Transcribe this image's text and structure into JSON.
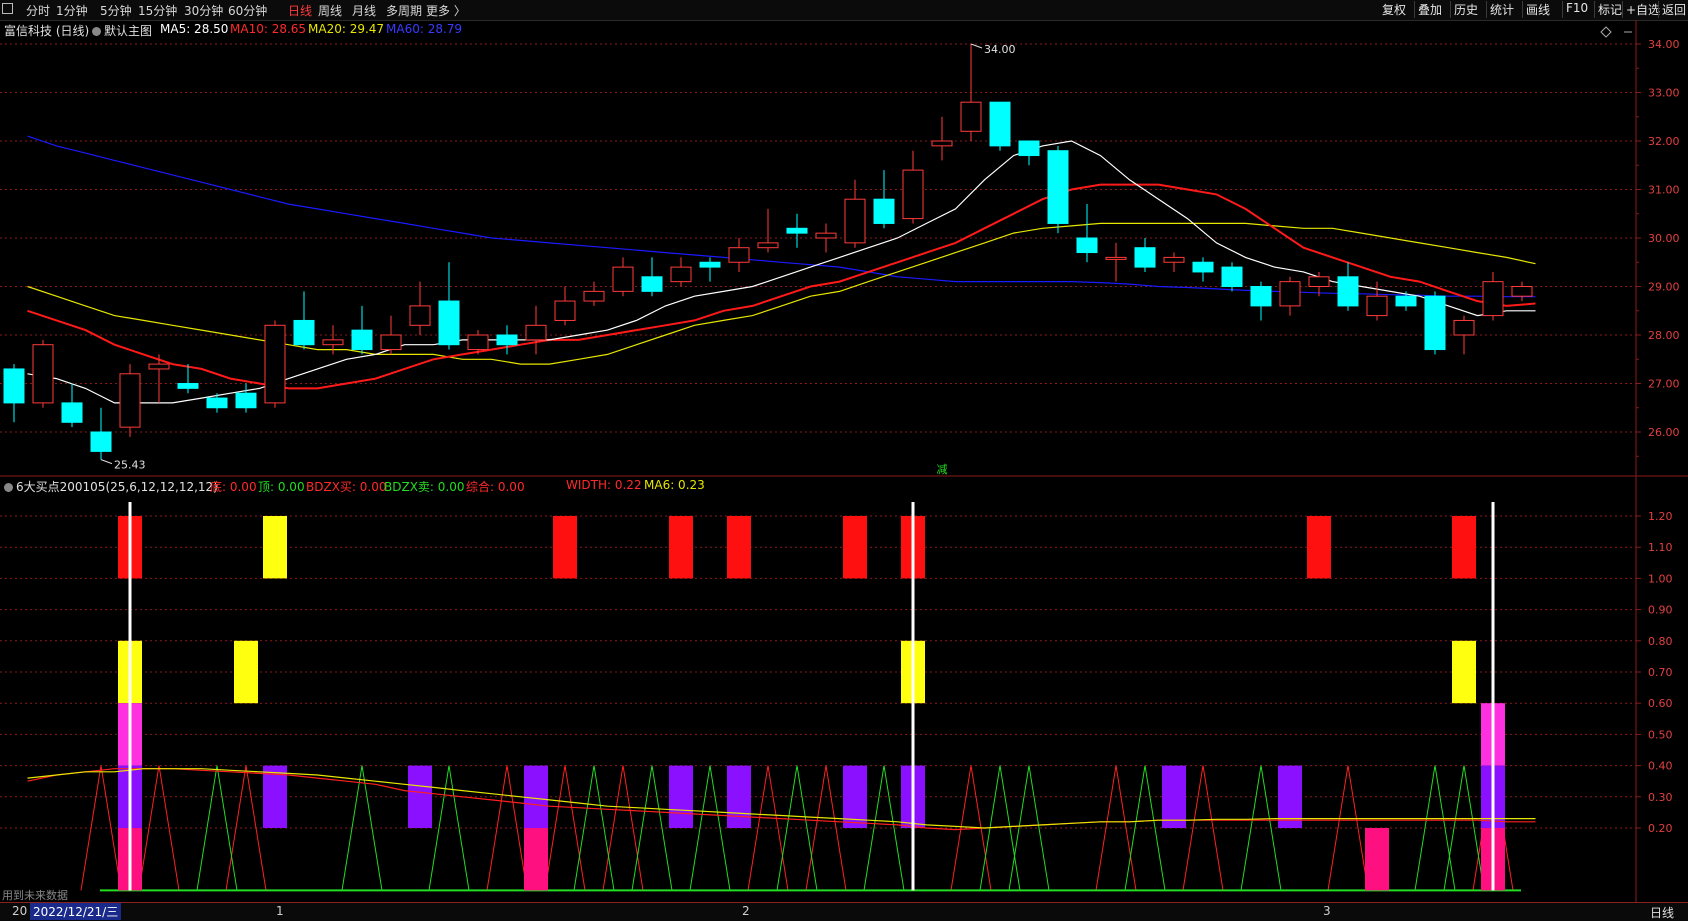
{
  "toolbar": {
    "periods": [
      "分时",
      "1分钟",
      "5分钟",
      "15分钟",
      "30分钟",
      "60分钟",
      "日线",
      "周线",
      "月线",
      "多周期",
      "更多 〉"
    ],
    "active": "日线",
    "right": [
      "复权",
      "叠加",
      "历史",
      "统计",
      "画线",
      "F10",
      "标记",
      "+自选",
      "返回"
    ]
  },
  "main_header": {
    "stock": "富信科技 (日线)",
    "template": "默认主图",
    "ma5": "MA5: 28.50",
    "ma10": "MA10: 28.65",
    "ma20": "MA20: 29.47",
    "ma60": "MA60: 28.79"
  },
  "sub_header": {
    "indicator": "6大买点200105(25,6,12,12,12,12)",
    "di": "底: 0.00",
    "ding": "顶: 0.00",
    "bdzx_buy": "BDZX买: 0.00",
    "bdzx_sell": "BDZX卖: 0.00",
    "zonghe": "综合: 0.00",
    "width": "WIDTH: 0.22",
    "ma6": "MA6: 0.23"
  },
  "annotations": {
    "high": "34.00",
    "low": "25.43",
    "jian": "减"
  },
  "overlay": {
    "future_data": "用到未来数据"
  },
  "bottom": {
    "date": "2022/12/21/三",
    "month1": "1",
    "month2": "2",
    "month3": "3",
    "left_clip": "20",
    "period": "日线"
  },
  "colors": {
    "up": "#ff3b3b",
    "down": "#00ffff",
    "ma5": "#ffffff",
    "ma10": "#ff1a1a",
    "ma20": "#e6e600",
    "ma60": "#1a1aff",
    "grid": "#8a1a1a"
  },
  "chart_data": [
    {
      "type": "candlestick",
      "title": "富信科技 (日线)",
      "y_ticks": [
        "34.00",
        "33.00",
        "32.00",
        "31.00",
        "30.00",
        "29.00",
        "28.00",
        "27.00",
        "26.00"
      ],
      "candles": [
        {
          "o": 27.3,
          "c": 26.6,
          "h": 27.4,
          "l": 26.2
        },
        {
          "o": 26.6,
          "c": 27.8,
          "h": 27.9,
          "l": 26.5
        },
        {
          "o": 26.6,
          "c": 26.2,
          "h": 27.0,
          "l": 26.1
        },
        {
          "o": 26.0,
          "c": 25.6,
          "h": 26.5,
          "l": 25.43
        },
        {
          "o": 26.1,
          "c": 27.2,
          "h": 27.4,
          "l": 25.9
        },
        {
          "o": 27.3,
          "c": 27.4,
          "h": 27.6,
          "l": 26.6
        },
        {
          "o": 27.0,
          "c": 26.9,
          "h": 27.4,
          "l": 26.8
        },
        {
          "o": 26.7,
          "c": 26.5,
          "h": 26.8,
          "l": 26.4
        },
        {
          "o": 26.8,
          "c": 26.5,
          "h": 27.0,
          "l": 26.4
        },
        {
          "o": 26.6,
          "c": 28.2,
          "h": 28.3,
          "l": 26.5
        },
        {
          "o": 28.3,
          "c": 27.8,
          "h": 28.9,
          "l": 27.7
        },
        {
          "o": 27.8,
          "c": 27.9,
          "h": 28.2,
          "l": 27.6
        },
        {
          "o": 28.1,
          "c": 27.7,
          "h": 28.6,
          "l": 27.6
        },
        {
          "o": 27.7,
          "c": 28.0,
          "h": 28.4,
          "l": 27.6
        },
        {
          "o": 28.2,
          "c": 28.6,
          "h": 29.1,
          "l": 28.0
        },
        {
          "o": 28.7,
          "c": 27.8,
          "h": 29.5,
          "l": 27.7
        },
        {
          "o": 27.7,
          "c": 28.0,
          "h": 28.1,
          "l": 27.6
        },
        {
          "o": 28.0,
          "c": 27.8,
          "h": 28.2,
          "l": 27.6
        },
        {
          "o": 27.9,
          "c": 28.2,
          "h": 28.6,
          "l": 27.6
        },
        {
          "o": 28.3,
          "c": 28.7,
          "h": 29.0,
          "l": 28.2
        },
        {
          "o": 28.7,
          "c": 28.9,
          "h": 29.1,
          "l": 28.6
        },
        {
          "o": 28.9,
          "c": 29.4,
          "h": 29.6,
          "l": 28.8
        },
        {
          "o": 29.2,
          "c": 28.9,
          "h": 29.6,
          "l": 28.8
        },
        {
          "o": 29.1,
          "c": 29.4,
          "h": 29.6,
          "l": 29.0
        },
        {
          "o": 29.5,
          "c": 29.4,
          "h": 29.6,
          "l": 29.1
        },
        {
          "o": 29.5,
          "c": 29.8,
          "h": 30.0,
          "l": 29.3
        },
        {
          "o": 29.8,
          "c": 29.9,
          "h": 30.6,
          "l": 29.7
        },
        {
          "o": 30.2,
          "c": 30.1,
          "h": 30.5,
          "l": 29.8
        },
        {
          "o": 30.0,
          "c": 30.1,
          "h": 30.3,
          "l": 29.7
        },
        {
          "o": 29.9,
          "c": 30.8,
          "h": 31.2,
          "l": 29.8
        },
        {
          "o": 30.8,
          "c": 30.3,
          "h": 31.4,
          "l": 30.2
        },
        {
          "o": 30.4,
          "c": 31.4,
          "h": 31.8,
          "l": 30.3
        },
        {
          "o": 31.9,
          "c": 32.0,
          "h": 32.5,
          "l": 31.6
        },
        {
          "o": 32.2,
          "c": 32.8,
          "h": 34.0,
          "l": 32.0
        },
        {
          "o": 32.8,
          "c": 31.9,
          "h": 32.8,
          "l": 31.8
        },
        {
          "o": 32.0,
          "c": 31.7,
          "h": 32.0,
          "l": 31.5
        },
        {
          "o": 31.8,
          "c": 30.3,
          "h": 31.9,
          "l": 30.1
        },
        {
          "o": 30.0,
          "c": 29.7,
          "h": 30.7,
          "l": 29.5
        },
        {
          "o": 29.6,
          "c": 29.6,
          "h": 29.9,
          "l": 29.1
        },
        {
          "o": 29.8,
          "c": 29.4,
          "h": 30.0,
          "l": 29.3
        },
        {
          "o": 29.5,
          "c": 29.6,
          "h": 29.7,
          "l": 29.3
        },
        {
          "o": 29.5,
          "c": 29.3,
          "h": 29.6,
          "l": 29.1
        },
        {
          "o": 29.4,
          "c": 29.0,
          "h": 29.5,
          "l": 28.9
        },
        {
          "o": 29.0,
          "c": 28.6,
          "h": 29.1,
          "l": 28.3
        },
        {
          "o": 28.6,
          "c": 29.1,
          "h": 29.2,
          "l": 28.4
        },
        {
          "o": 29.0,
          "c": 29.2,
          "h": 29.3,
          "l": 28.8
        },
        {
          "o": 29.2,
          "c": 28.6,
          "h": 29.5,
          "l": 28.5
        },
        {
          "o": 28.4,
          "c": 28.8,
          "h": 29.1,
          "l": 28.3
        },
        {
          "o": 28.8,
          "c": 28.6,
          "h": 28.9,
          "l": 28.5
        },
        {
          "o": 28.8,
          "c": 27.7,
          "h": 28.9,
          "l": 27.6
        },
        {
          "o": 28.0,
          "c": 28.3,
          "h": 28.4,
          "l": 27.6
        },
        {
          "o": 28.4,
          "c": 29.1,
          "h": 29.3,
          "l": 28.3
        },
        {
          "o": 28.8,
          "c": 29.0,
          "h": 29.1,
          "l": 28.7
        }
      ],
      "ma5": [
        27.2,
        27.1,
        26.9,
        26.6,
        26.6,
        26.6,
        26.7,
        26.8,
        26.9,
        27.1,
        27.3,
        27.5,
        27.6,
        27.8,
        27.8,
        27.9,
        27.9,
        27.9,
        27.9,
        28.0,
        28.1,
        28.3,
        28.6,
        28.8,
        28.9,
        29.0,
        29.2,
        29.4,
        29.6,
        29.8,
        30.0,
        30.3,
        30.6,
        31.2,
        31.7,
        31.9,
        32.0,
        31.7,
        31.2,
        30.8,
        30.4,
        29.9,
        29.6,
        29.4,
        29.3,
        29.1,
        29.0,
        28.9,
        28.8,
        28.6,
        28.4,
        28.5,
        28.5
      ],
      "ma10": [
        28.5,
        28.3,
        28.1,
        27.8,
        27.6,
        27.4,
        27.3,
        27.1,
        27.0,
        26.9,
        26.9,
        27.0,
        27.1,
        27.3,
        27.5,
        27.6,
        27.7,
        27.8,
        27.9,
        27.9,
        28.0,
        28.1,
        28.2,
        28.3,
        28.5,
        28.6,
        28.8,
        29.0,
        29.1,
        29.3,
        29.5,
        29.7,
        29.9,
        30.2,
        30.5,
        30.8,
        31.0,
        31.1,
        31.1,
        31.1,
        31.0,
        30.9,
        30.6,
        30.2,
        29.8,
        29.6,
        29.4,
        29.2,
        29.1,
        28.9,
        28.7,
        28.6,
        28.65
      ],
      "ma20": [
        29.0,
        28.8,
        28.6,
        28.4,
        28.3,
        28.2,
        28.1,
        28.0,
        27.9,
        27.8,
        27.7,
        27.7,
        27.6,
        27.6,
        27.6,
        27.5,
        27.5,
        27.4,
        27.4,
        27.5,
        27.6,
        27.8,
        28.0,
        28.2,
        28.3,
        28.4,
        28.6,
        28.8,
        28.9,
        29.1,
        29.3,
        29.5,
        29.7,
        29.9,
        30.1,
        30.2,
        30.25,
        30.3,
        30.3,
        30.3,
        30.3,
        30.3,
        30.3,
        30.25,
        30.2,
        30.2,
        30.1,
        30.0,
        29.9,
        29.8,
        29.7,
        29.6,
        29.47
      ],
      "ma60": [
        32.1,
        31.9,
        31.75,
        31.6,
        31.45,
        31.3,
        31.15,
        31.0,
        30.85,
        30.7,
        30.6,
        30.5,
        30.4,
        30.3,
        30.2,
        30.1,
        30.0,
        29.95,
        29.9,
        29.85,
        29.8,
        29.75,
        29.7,
        29.65,
        29.6,
        29.55,
        29.5,
        29.45,
        29.4,
        29.3,
        29.2,
        29.15,
        29.1,
        29.1,
        29.1,
        29.1,
        29.1,
        29.08,
        29.05,
        29.0,
        28.98,
        28.95,
        28.92,
        28.9,
        28.88,
        28.86,
        28.85,
        28.83,
        28.82,
        28.8,
        28.8,
        28.79,
        28.79
      ]
    },
    {
      "type": "bar",
      "title": "6大买点200105(25,6,12,12,12,12)",
      "y_ticks": [
        "1.20",
        "1.10",
        "1.00",
        "0.90",
        "0.80",
        "0.70",
        "0.60",
        "0.50",
        "0.40",
        "0.30",
        "0.20"
      ],
      "blocks": [
        {
          "i": 4,
          "y0": 1.0,
          "y1": 1.2,
          "c": "red"
        },
        {
          "i": 9,
          "y0": 1.0,
          "y1": 1.2,
          "c": "yellow"
        },
        {
          "i": 19,
          "y0": 1.0,
          "y1": 1.2,
          "c": "red"
        },
        {
          "i": 23,
          "y0": 1.0,
          "y1": 1.2,
          "c": "red"
        },
        {
          "i": 25,
          "y0": 1.0,
          "y1": 1.2,
          "c": "red"
        },
        {
          "i": 29,
          "y0": 1.0,
          "y1": 1.2,
          "c": "red"
        },
        {
          "i": 31,
          "y0": 1.0,
          "y1": 1.2,
          "c": "red"
        },
        {
          "i": 45,
          "y0": 1.0,
          "y1": 1.2,
          "c": "red"
        },
        {
          "i": 50,
          "y0": 1.0,
          "y1": 1.2,
          "c": "red"
        },
        {
          "i": 4,
          "y0": 0.6,
          "y1": 0.8,
          "c": "yellow"
        },
        {
          "i": 8,
          "y0": 0.6,
          "y1": 0.8,
          "c": "yellow"
        },
        {
          "i": 31,
          "y0": 0.6,
          "y1": 0.8,
          "c": "yellow"
        },
        {
          "i": 50,
          "y0": 0.6,
          "y1": 0.8,
          "c": "yellow"
        },
        {
          "i": 4,
          "y0": 0.4,
          "y1": 0.6,
          "c": "magenta"
        },
        {
          "i": 51,
          "y0": 0.4,
          "y1": 0.6,
          "c": "magenta"
        },
        {
          "i": 4,
          "y0": 0.2,
          "y1": 0.4,
          "c": "purple"
        },
        {
          "i": 9,
          "y0": 0.2,
          "y1": 0.4,
          "c": "purple"
        },
        {
          "i": 14,
          "y0": 0.2,
          "y1": 0.4,
          "c": "purple"
        },
        {
          "i": 18,
          "y0": 0.2,
          "y1": 0.4,
          "c": "purple"
        },
        {
          "i": 23,
          "y0": 0.2,
          "y1": 0.4,
          "c": "purple"
        },
        {
          "i": 25,
          "y0": 0.2,
          "y1": 0.4,
          "c": "purple"
        },
        {
          "i": 29,
          "y0": 0.2,
          "y1": 0.4,
          "c": "purple"
        },
        {
          "i": 31,
          "y0": 0.2,
          "y1": 0.4,
          "c": "purple"
        },
        {
          "i": 40,
          "y0": 0.2,
          "y1": 0.4,
          "c": "purple"
        },
        {
          "i": 44,
          "y0": 0.2,
          "y1": 0.4,
          "c": "purple"
        },
        {
          "i": 51,
          "y0": 0.2,
          "y1": 0.4,
          "c": "purple"
        },
        {
          "i": 4,
          "y0": 0.0,
          "y1": 0.2,
          "c": "pink"
        },
        {
          "i": 18,
          "y0": 0.0,
          "y1": 0.2,
          "c": "pink"
        },
        {
          "i": 47,
          "y0": 0.0,
          "y1": 0.2,
          "c": "pink"
        },
        {
          "i": 51,
          "y0": 0.0,
          "y1": 0.2,
          "c": "pink"
        }
      ],
      "white_lines": [
        4,
        31,
        51
      ],
      "green_peaks": [
        7,
        12,
        15,
        20,
        22,
        24,
        27,
        30,
        34,
        35,
        39,
        43,
        49,
        50
      ],
      "red_peaks": [
        3,
        5,
        8,
        17,
        19,
        21,
        26,
        28,
        33,
        38,
        41,
        46,
        51
      ],
      "width_line": [
        0.35,
        0.37,
        0.38,
        0.39,
        0.39,
        0.39,
        0.385,
        0.38,
        0.375,
        0.37,
        0.36,
        0.35,
        0.34,
        0.32,
        0.31,
        0.3,
        0.29,
        0.28,
        0.27,
        0.265,
        0.26,
        0.255,
        0.25,
        0.245,
        0.24,
        0.235,
        0.23,
        0.225,
        0.22,
        0.215,
        0.21,
        0.2,
        0.195,
        0.2,
        0.205,
        0.21,
        0.215,
        0.22,
        0.22,
        0.225,
        0.225,
        0.225,
        0.225,
        0.225,
        0.225,
        0.225,
        0.225,
        0.225,
        0.225,
        0.225,
        0.225,
        0.22,
        0.22
      ],
      "ma6_line": [
        0.36,
        0.37,
        0.38,
        0.38,
        0.39,
        0.39,
        0.39,
        0.385,
        0.38,
        0.375,
        0.37,
        0.36,
        0.35,
        0.34,
        0.33,
        0.32,
        0.31,
        0.3,
        0.29,
        0.28,
        0.27,
        0.265,
        0.26,
        0.255,
        0.25,
        0.245,
        0.24,
        0.235,
        0.23,
        0.225,
        0.22,
        0.21,
        0.205,
        0.2,
        0.205,
        0.21,
        0.215,
        0.22,
        0.22,
        0.225,
        0.225,
        0.228,
        0.228,
        0.23,
        0.23,
        0.23,
        0.23,
        0.23,
        0.23,
        0.23,
        0.23,
        0.23,
        0.23
      ]
    }
  ]
}
